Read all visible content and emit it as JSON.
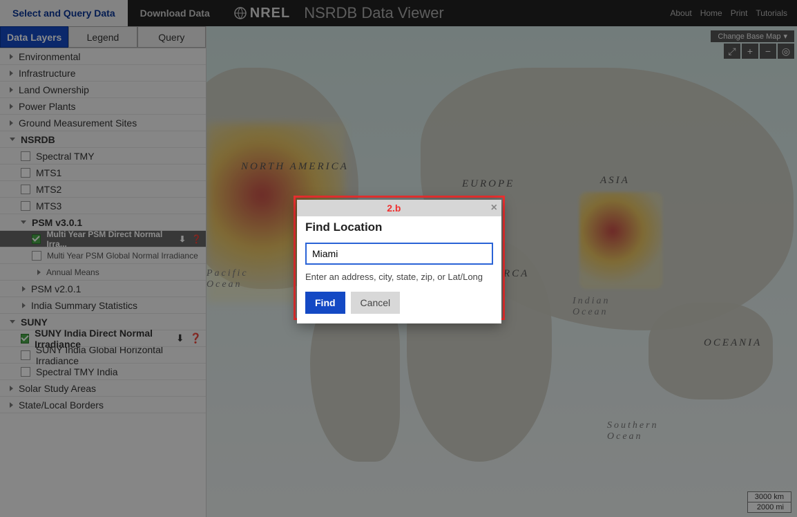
{
  "topbar": {
    "select_query": "Select and Query Data",
    "download": "Download Data",
    "brand": "NREL",
    "title": "NSRDB Data Viewer",
    "links": [
      "About",
      "Home",
      "Print",
      "Tutorials"
    ]
  },
  "tabs": {
    "data_layers": "Data Layers",
    "legend": "Legend",
    "query": "Query"
  },
  "tree": {
    "environmental": "Environmental",
    "infrastructure": "Infrastructure",
    "land_ownership": "Land Ownership",
    "power_plants": "Power Plants",
    "ground_measurement": "Ground Measurement Sites",
    "nsrdb": "NSRDB",
    "spectral_tmy": "Spectral TMY",
    "mts1": "MTS1",
    "mts2": "MTS2",
    "mts3": "MTS3",
    "psm301": "PSM v3.0.1",
    "psm_dn": "Multi Year PSM Direct Normal Irra...",
    "psm_gn": "Multi Year PSM Global Normal Irradiance",
    "annual_means": "Annual Means",
    "psm201": "PSM v2.0.1",
    "india_summary": "India Summary Statistics",
    "suny": "SUNY",
    "suny_dn": "SUNY India Direct Normal Irradiance",
    "suny_gh": "SUNY India Global Horizontal Irradiance",
    "spectral_tmy_india": "Spectral TMY India",
    "solar_study": "Solar Study Areas",
    "state_local": "State/Local Borders"
  },
  "map": {
    "change_basemap": "Change Base Map",
    "labels": {
      "north_america": "NORTH AMERICA",
      "europe": "EUROPE",
      "asia": "ASIA",
      "oceania": "OCEANIA",
      "rca": "RCA",
      "pacific_ocean": "Pacific Ocean",
      "indian_ocean": "Indian Ocean",
      "southern_ocean": "Southern Ocean"
    },
    "scale": {
      "km": "3000 km",
      "mi": "2000 mi"
    }
  },
  "annotation": "2.b",
  "dialog": {
    "title": "Find Location",
    "value": "Miami",
    "hint": "Enter an address, city, state, zip, or Lat/Long",
    "find": "Find",
    "cancel": "Cancel"
  }
}
